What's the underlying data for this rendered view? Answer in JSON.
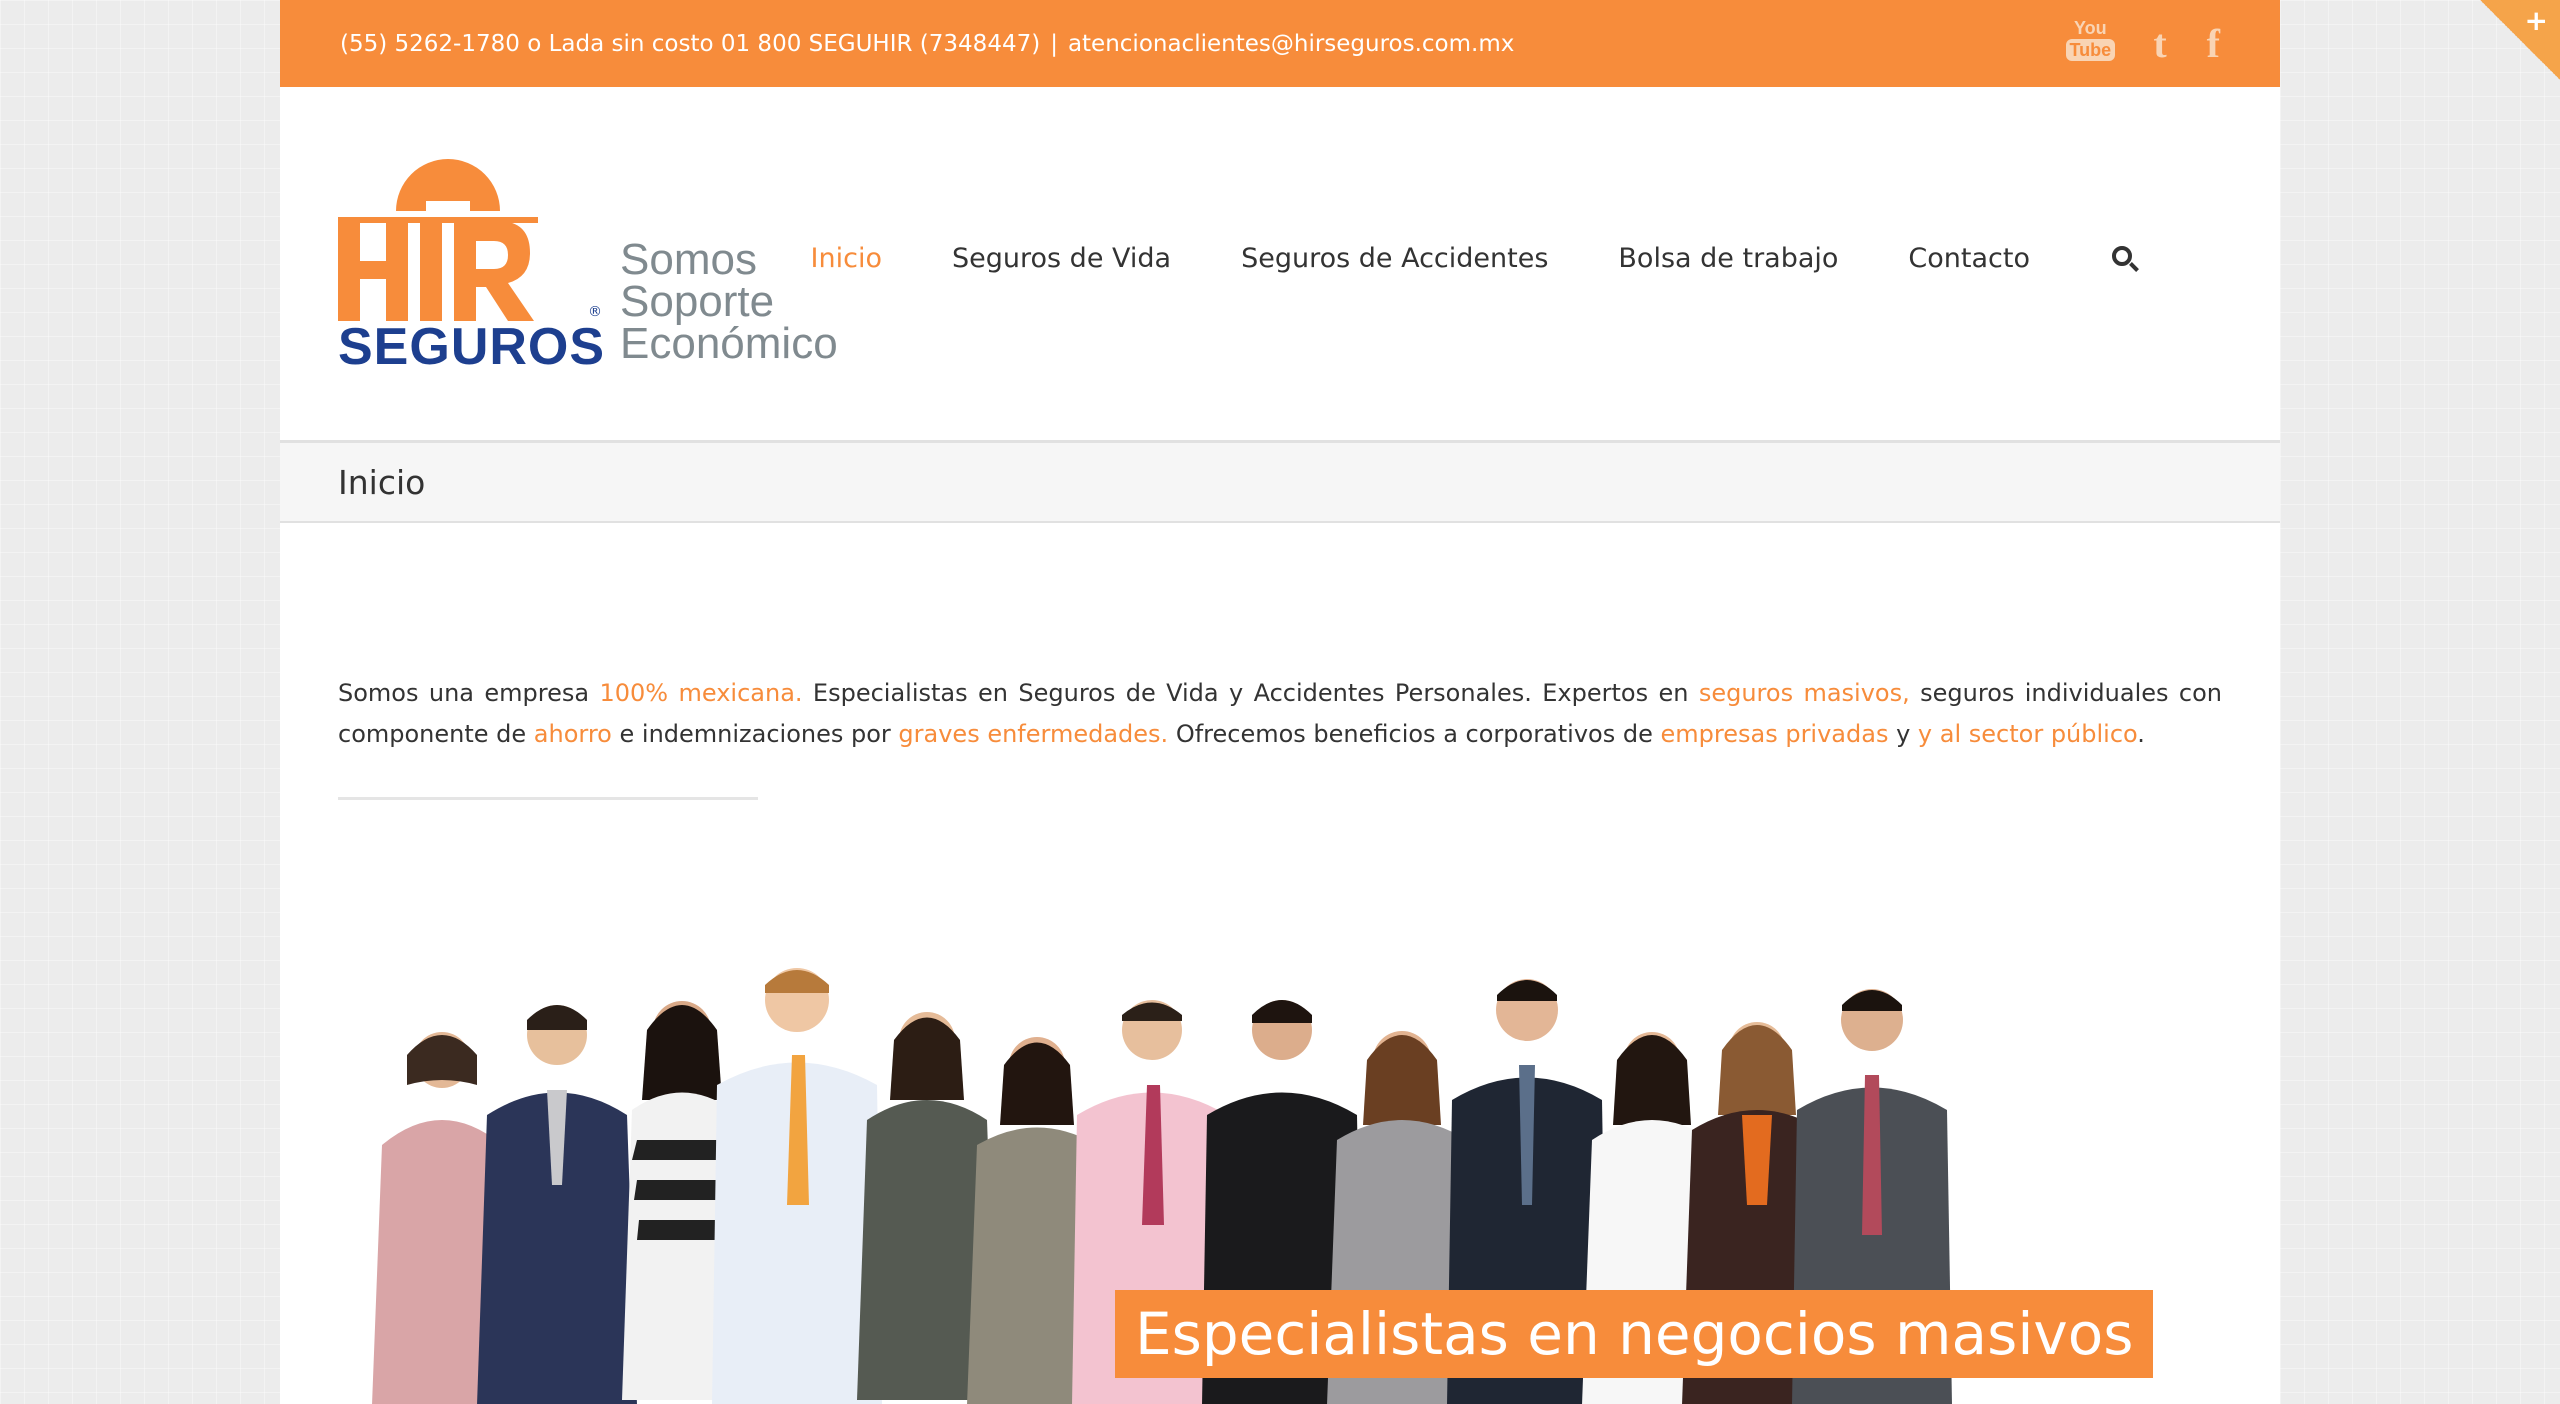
{
  "topbar": {
    "phone": "(55) 5262-1780 o Lada sin costo 01 800 SEGUHIR (7348447)",
    "separator": "|",
    "email": "atencionaclientes@hirseguros.com.mx",
    "social": [
      {
        "name": "youtube-icon",
        "top": "You",
        "bottom": "Tube"
      },
      {
        "name": "twitter-icon",
        "glyph": "t"
      },
      {
        "name": "facebook-icon",
        "glyph": "f"
      }
    ]
  },
  "logo": {
    "mark": "HIR",
    "seguros": "SEGUROS",
    "reg": "®",
    "tagline": [
      "Somos",
      "Soporte",
      "Económico"
    ]
  },
  "nav": {
    "items": [
      "Inicio",
      "Seguros de Vida",
      "Seguros de Accidentes",
      "Bolsa de trabajo",
      "Contacto"
    ],
    "active_index": 0
  },
  "page_title": "Inicio",
  "intro": {
    "p1": "Somos una empresa ",
    "h1": "100% mexicana.",
    "p2": " Especialistas en Seguros de Vida y Accidentes Personales. Expertos en ",
    "h2": "seguros masivos,",
    "p3": " seguros individuales con componente de ",
    "h3": "ahorro",
    "p4": " e indemnizaciones por ",
    "h4": "graves enfermedades.",
    "p5": " Ofrecemos beneficios a corporativos de ",
    "h5": "empresas privadas",
    "p6": " y ",
    "h6": "y al sector público",
    "p7": "."
  },
  "banner": {
    "caption": "Especialistas en negocios masivos"
  },
  "colors": {
    "accent": "#f78c3b",
    "logo_blue": "#1d3f8f",
    "logo_gray": "#808a8f"
  }
}
